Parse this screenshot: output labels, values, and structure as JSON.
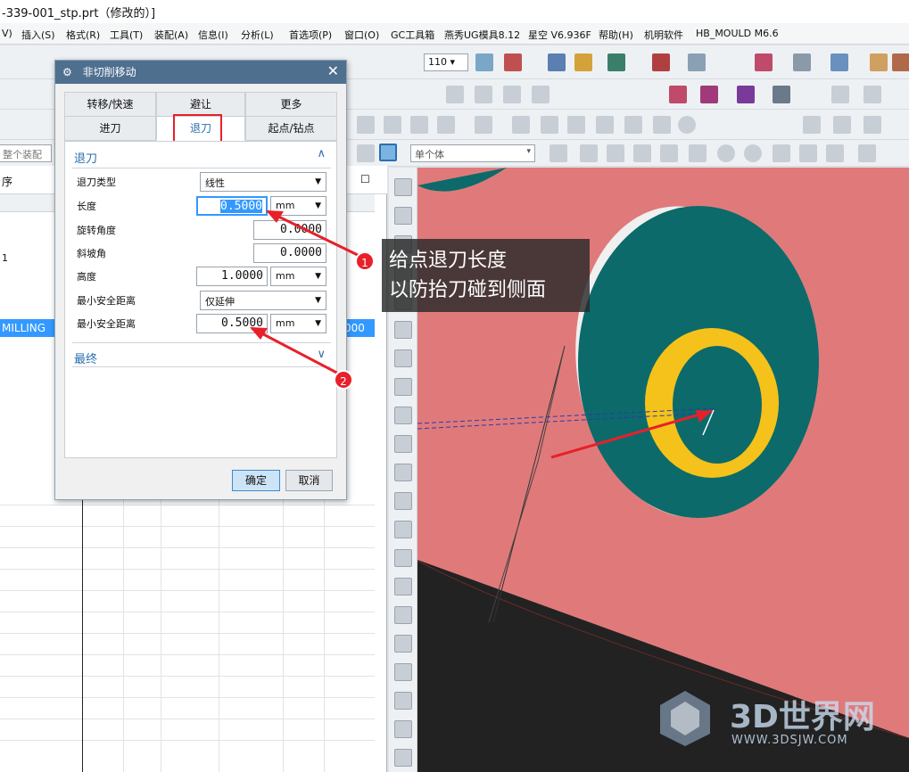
{
  "window": {
    "title": "-339-001_stp.prt（修改的）]"
  },
  "menu": [
    "V)",
    "插入(S)",
    "格式(R)",
    "工具(T)",
    "装配(A)",
    "信息(I)",
    "分析(L)",
    "首选项(P)",
    "窗口(O)",
    "GC工具箱",
    "燕秀UG模具8.12",
    "星空 V6.936F",
    "帮助(H)",
    "机明软件",
    "HB_MOULD M6.6"
  ],
  "toolbar": {
    "zoom_value": "110",
    "whole_assembly": "整个装配",
    "single_body": "单个体"
  },
  "navigator": {
    "header_col": "序",
    "row_label": "MILLING",
    "row_value": "000",
    "short_row": "1"
  },
  "dialog": {
    "title": "非切削移动",
    "tabs_row1": [
      "转移/快速",
      "避让",
      "更多"
    ],
    "tabs_row2": [
      "进刀",
      "退刀",
      "起点/钻点"
    ],
    "active_tab": "退刀",
    "section_retract": "退刀",
    "section_final": "最终",
    "fields": [
      {
        "label": "退刀类型",
        "type": "select",
        "value": "线性"
      },
      {
        "label": "长度",
        "value": "0.5000",
        "unit": "mm",
        "highlighted": true
      },
      {
        "label": "旋转角度",
        "value": "0.0000"
      },
      {
        "label": "斜坡角",
        "value": "0.0000"
      },
      {
        "label": "高度",
        "value": "1.0000",
        "unit": "mm"
      },
      {
        "label": "最小安全距离",
        "type": "select",
        "value": "仅延伸"
      },
      {
        "label": "最小安全距离",
        "value": "0.5000",
        "unit": "mm"
      }
    ],
    "ok_label": "确定",
    "cancel_label": "取消"
  },
  "annotation": {
    "line1": "给点退刀长度",
    "line2": "以防抬刀碰到侧面",
    "badge1": "1",
    "badge2": "2"
  },
  "watermark": {
    "brand": "3D世界网",
    "url": "WWW.3DSJW.COM"
  },
  "colors": {
    "model": "#e07a7a",
    "boss": "#0c6a6a",
    "ring": "#f4c21a",
    "callout_red": "#e8202a",
    "highlight": "#3399ff"
  }
}
